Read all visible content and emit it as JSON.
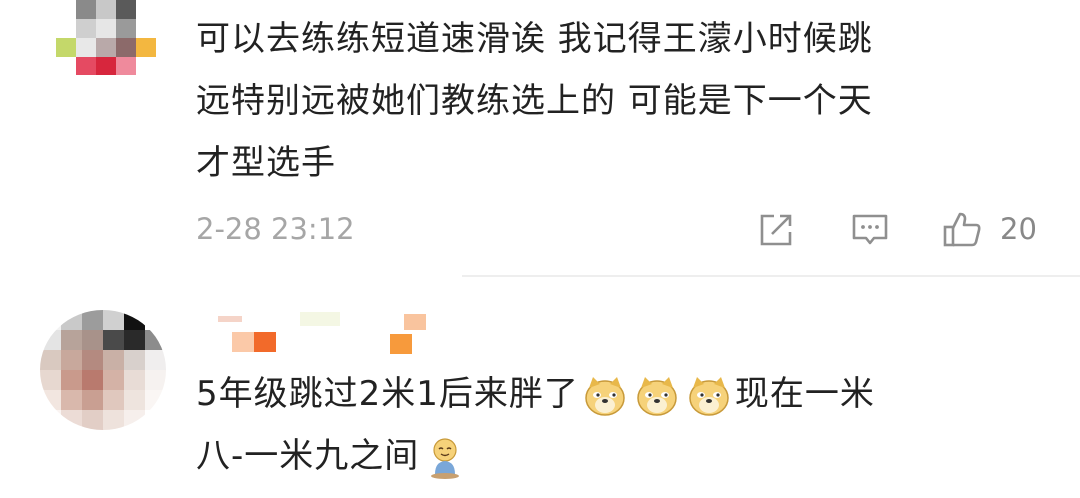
{
  "comments": [
    {
      "text_lines": [
        "可以去练练短道速滑诶 我记得王濛小时候跳",
        "远特别远被她们教练选上的 可能是下一个天",
        "才型选手"
      ],
      "timestamp": "2-28 23:12",
      "likes": "20"
    },
    {
      "line1_before": "5年级跳过2米1后来胖了",
      "line1_after": "现在一米",
      "line2": "八-一米九之间",
      "emojis": [
        "doge-emoji",
        "doge-emoji",
        "doge-emoji",
        "sitting-smile-emoji"
      ]
    }
  ],
  "colors": {
    "text": "#222222",
    "meta": "#a6a6a6",
    "divider": "#eeeeee"
  }
}
